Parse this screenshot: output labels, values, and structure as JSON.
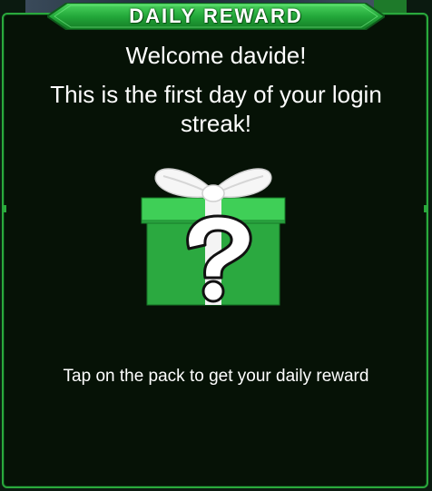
{
  "dialog": {
    "title": "DAILY REWARD",
    "welcome": "Welcome davide!",
    "streak_message": "This is the first day of your login streak!",
    "hint": "Tap on the pack to get your daily reward"
  },
  "icons": {
    "gift": "mystery-gift-box-icon",
    "question": "question-mark-icon"
  },
  "colors": {
    "accent": "#2aa83c",
    "panel_bg": "#061206",
    "gift_green": "#33c24a",
    "ribbon": "#ffffff"
  }
}
